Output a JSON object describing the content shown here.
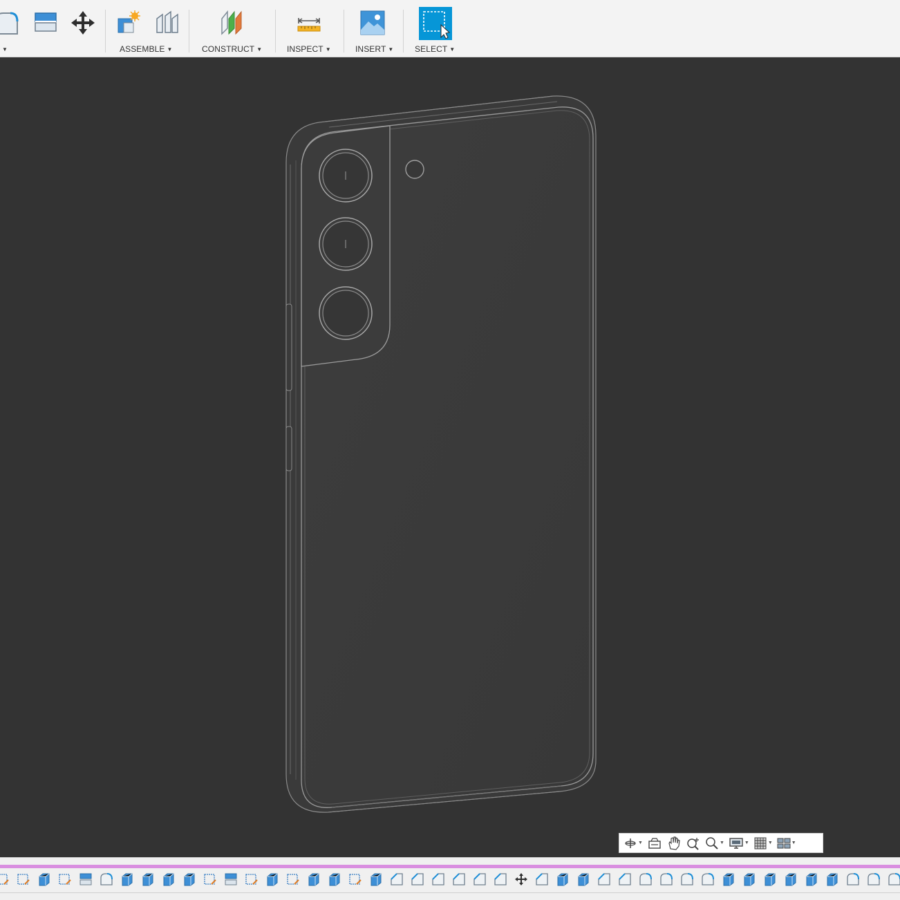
{
  "toolbar": {
    "groups": [
      {
        "id": "assemble",
        "label": "ASSEMBLE"
      },
      {
        "id": "construct",
        "label": "CONSTRUCT"
      },
      {
        "id": "inspect",
        "label": "INSPECT"
      },
      {
        "id": "insert",
        "label": "INSERT"
      },
      {
        "id": "select",
        "label": "SELECT"
      }
    ],
    "icons": [
      "fillet-icon",
      "press-pull-icon",
      "move-icon",
      "new-component-icon",
      "joint-icon",
      "offset-plane-icon",
      "measure-icon",
      "insert-canvas-icon",
      "select-window-icon"
    ],
    "accent_color": "#0696d7"
  },
  "viewport": {
    "background": "#333333",
    "model": "phone-back-body",
    "camera_lenses": 3
  },
  "navbar": {
    "tools": [
      "orbit-icon",
      "look-at-icon",
      "pan-icon",
      "zoom-icon",
      "fit-icon",
      "display-settings-icon",
      "grid-settings-icon",
      "viewports-icon"
    ]
  },
  "timeline": {
    "marker_color": "#d98ee0",
    "features": [
      "sketch",
      "sketch",
      "extrude",
      "sketch",
      "offset-face",
      "fillet",
      "extrude",
      "extrude",
      "extrude",
      "extrude",
      "sketch",
      "offset-face",
      "sketch",
      "extrude",
      "sketch",
      "extrude",
      "extrude",
      "sketch",
      "extrude",
      "chamfer",
      "chamfer",
      "chamfer",
      "chamfer",
      "chamfer",
      "chamfer",
      "move",
      "chamfer",
      "extrude",
      "extrude",
      "chamfer",
      "chamfer",
      "fillet",
      "fillet",
      "fillet",
      "fillet",
      "extrude",
      "extrude",
      "extrude",
      "extrude",
      "extrude",
      "extrude",
      "fillet",
      "fillet",
      "fillet"
    ]
  }
}
